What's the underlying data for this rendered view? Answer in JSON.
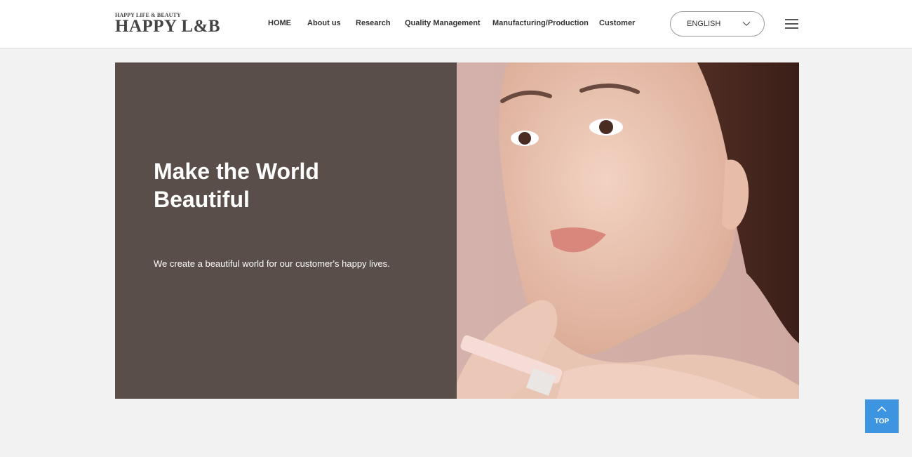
{
  "header": {
    "logo_small": "HAPPY LIFE & BEAUTY",
    "logo_big": "HAPPY L&B",
    "nav": [
      {
        "label": "HOME"
      },
      {
        "label": "About us"
      },
      {
        "label": "Research"
      },
      {
        "label": "Quality Management"
      },
      {
        "label": "Manufacturing/Production"
      },
      {
        "label": "Customer"
      }
    ],
    "language": {
      "selected": "ENGLISH",
      "icon": "chevron-down-icon"
    },
    "menu_icon": "hamburger-menu-icon"
  },
  "hero": {
    "title_line1": "Make the World",
    "title_line2": "Beautiful",
    "subtitle": "We create a beautiful world for our customer's happy lives."
  },
  "top_button": {
    "label": "TOP",
    "icon": "arrow-up-icon"
  },
  "colors": {
    "accent": "#3d94e0",
    "overlay": "#504642",
    "page_bg": "#f2f2f2"
  }
}
